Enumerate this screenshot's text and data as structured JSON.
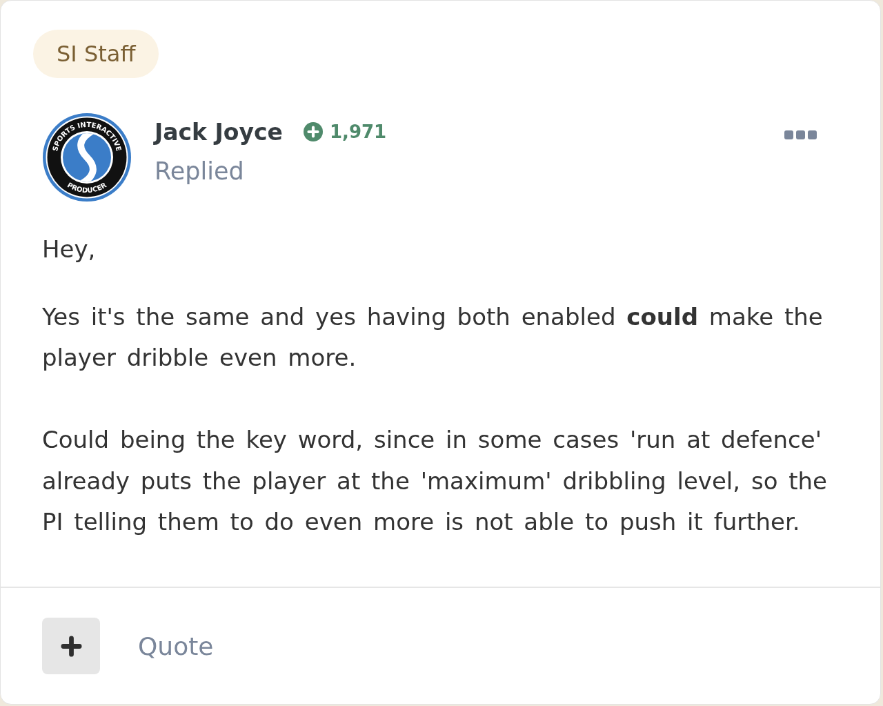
{
  "badge": {
    "label": "SI Staff"
  },
  "author": {
    "name": "Jack Joyce",
    "reputation": "1,971",
    "action": "Replied",
    "avatar": {
      "ring_top": "SPORTS INTERACTIVE",
      "ring_bottom": "PRODUCER"
    }
  },
  "post": {
    "paragraphs": [
      "Hey,",
      "Yes it's the same and yes having both enabled **could** make the player dribble even more.",
      "Could being the key word, since in some cases 'run at defence' already puts the player at the 'maximum' dribbling level, so the PI telling them to do even more is not able to push it further."
    ]
  },
  "footer": {
    "buttons": [
      {
        "kind": "react"
      },
      {
        "kind": "quote",
        "label": "Quote"
      }
    ]
  }
}
